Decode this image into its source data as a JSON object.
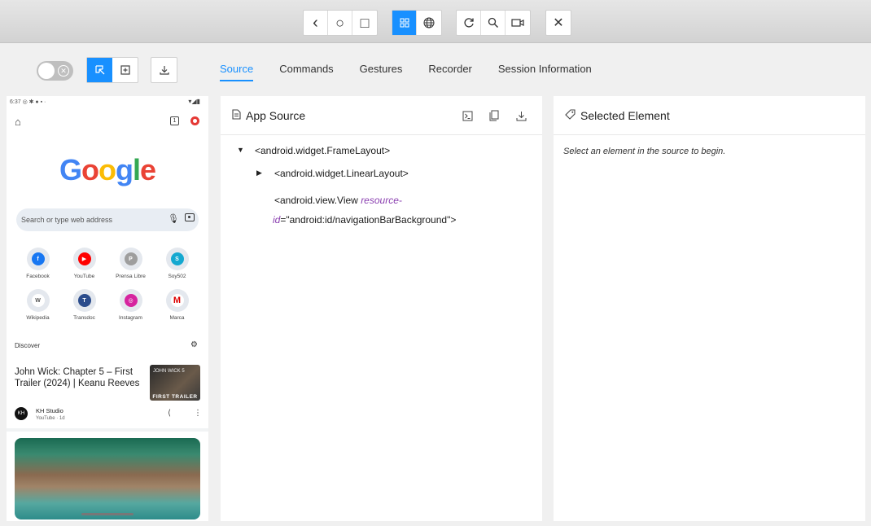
{
  "toolbar": {
    "back_icon": "‹",
    "home_icon": "○",
    "overview_icon": "□",
    "close_icon": "✕"
  },
  "tabs": [
    "Source",
    "Commands",
    "Gestures",
    "Recorder",
    "Session Information"
  ],
  "phone": {
    "status_time": "6:37",
    "tabs_count": "1",
    "google_letters": [
      "G",
      "o",
      "o",
      "g",
      "l",
      "e"
    ],
    "search_placeholder": "Search or type web address",
    "shortcuts": [
      {
        "label": "Facebook",
        "glyph": "f",
        "color": "#1877f2"
      },
      {
        "label": "YouTube",
        "glyph": "▶",
        "color": "#ff0000"
      },
      {
        "label": "Prensa Libre",
        "glyph": "P",
        "color": "#9e9e9e"
      },
      {
        "label": "Soy502",
        "glyph": "S",
        "color": "#14a8d0"
      },
      {
        "label": "Wikipedia",
        "glyph": "W",
        "color": "#ffffff"
      },
      {
        "label": "Transdoc",
        "glyph": "T",
        "color": "#2b4c8c"
      },
      {
        "label": "Instagram",
        "glyph": "◎",
        "color": "#d6249f"
      },
      {
        "label": "Marca",
        "glyph": "M",
        "color": "#ffffff"
      }
    ],
    "discover_label": "Discover",
    "article_title": "John Wick: Chapter 5 – First Trailer (2024) | Keanu Reeves",
    "thumb_label": "FIRST TRAILER",
    "thumb_top": "JOHN WICK 5",
    "channel_name": "KH Studio",
    "channel_meta": "YouTube · 1d",
    "channel_avatar": "KH"
  },
  "app_source": {
    "title": "App Source",
    "nodes": [
      {
        "tag": "<android.widget.FrameLayout>"
      },
      {
        "tag": "<android.widget.LinearLayout>"
      },
      {
        "tag": "<android.view.View",
        "attr_part1": "resource-",
        "attr_part2": "id",
        "value": "=\"android:id/navigationBarBackground\">"
      }
    ]
  },
  "selected_element": {
    "title": "Selected Element",
    "hint": "Select an element in the source to begin."
  }
}
